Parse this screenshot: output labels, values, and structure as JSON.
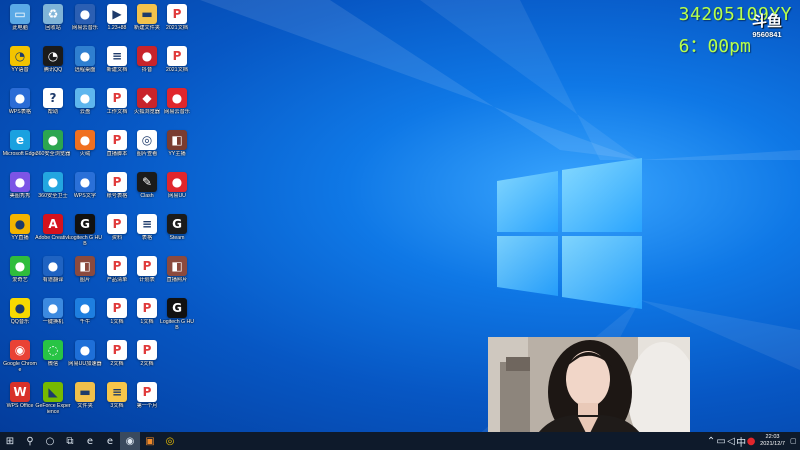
{
  "overlay": {
    "room_id": "34205109YY",
    "schedule": "6：00pm",
    "badge_title": "斗鱼",
    "badge_number": "9560841"
  },
  "desktop": {
    "columns": [
      [
        {
          "label": "此电脑",
          "icon": "computer-icon",
          "color": "#5aa9e6"
        },
        {
          "label": "YY语音",
          "icon": "yy-icon",
          "color": "#f3c400"
        },
        {
          "label": "WPS表格",
          "icon": "spreadsheet-icon",
          "color": "#2b6cd6"
        },
        {
          "label": "Microsoft Edge",
          "icon": "edge-icon",
          "color": "#1aa1e0"
        },
        {
          "label": "美图秀秀",
          "icon": "meitu-icon",
          "color": "#7c55e6"
        },
        {
          "label": "YY直播",
          "icon": "yy-live-icon",
          "color": "#f3b400"
        },
        {
          "label": "爱奇艺",
          "icon": "iqiyi-icon",
          "color": "#2fbd3c"
        },
        {
          "label": "QQ音乐",
          "icon": "qq-music-icon",
          "color": "#f7d900"
        },
        {
          "label": "Google Chrome",
          "icon": "chrome-icon",
          "color": "#e94235"
        },
        {
          "label": "WPS Office",
          "icon": "wps-icon",
          "color": "#d8322a"
        }
      ],
      [
        {
          "label": "回收站",
          "icon": "recycle-bin-icon",
          "color": "#7fb4d8"
        },
        {
          "label": "腾讯QQ",
          "icon": "qq-icon",
          "color": "#1b1b1b"
        },
        {
          "label": "帮助",
          "icon": "help-icon",
          "color": "#ffffff"
        },
        {
          "label": "360安全浏览器",
          "icon": "browser-360-icon",
          "color": "#2ca64f"
        },
        {
          "label": "360安全卫士",
          "icon": "security-360-icon",
          "color": "#23a6e0"
        },
        {
          "label": "Adobe Creative",
          "icon": "adobe-icon",
          "color": "#d5121d"
        },
        {
          "label": "有道翻译",
          "icon": "translate-icon",
          "color": "#1f63c2"
        },
        {
          "label": "一键换机",
          "icon": "migrate-icon",
          "color": "#3c8ae0"
        },
        {
          "label": "微信",
          "icon": "wechat-icon",
          "color": "#28c445"
        },
        {
          "label": "GeForce Experience",
          "icon": "nvidia-icon",
          "color": "#76b900"
        }
      ],
      [
        {
          "label": "网易云音乐",
          "icon": "clock-app-icon",
          "color": "#2b5fb3"
        },
        {
          "label": "远程桌面",
          "icon": "remote-desktop-icon",
          "color": "#2f7fd0"
        },
        {
          "label": "云盘",
          "icon": "cloud-drive-icon",
          "color": "#5eb6ee"
        },
        {
          "label": "火绒",
          "icon": "huorong-icon",
          "color": "#f07020"
        },
        {
          "label": "WPS文字",
          "icon": "wps-writer-icon",
          "color": "#2a70d8"
        },
        {
          "label": "Logitech G HUB",
          "icon": "logitech-icon",
          "color": "#111111"
        },
        {
          "label": "图片",
          "icon": "photo-icon",
          "color": "#8b4a3e"
        },
        {
          "label": "千牛",
          "icon": "qianniu-icon",
          "color": "#1e7fe0"
        },
        {
          "label": "网易UU加速器",
          "icon": "uu-icon",
          "color": "#1e6fd8"
        },
        {
          "label": "文件夹",
          "icon": "folder-icon",
          "color": "#f1c04b"
        }
      ],
      [
        {
          "label": "1.23+88",
          "icon": "media-icon",
          "color": "#ffffff"
        },
        {
          "label": "新建文档",
          "icon": "document-icon",
          "color": "#ffffff"
        },
        {
          "label": "工作文档",
          "icon": "pdf-icon",
          "color": "#ffffff"
        },
        {
          "label": "直播脚本",
          "icon": "pdf-icon",
          "color": "#ffffff"
        },
        {
          "label": "账号表格",
          "icon": "pdf-icon",
          "color": "#ffffff"
        },
        {
          "label": "资料",
          "icon": "pdf-icon",
          "color": "#ffffff"
        },
        {
          "label": "产品清单",
          "icon": "pdf-icon",
          "color": "#ffffff"
        },
        {
          "label": "1文档",
          "icon": "pdf-icon",
          "color": "#ffffff"
        },
        {
          "label": "2文档",
          "icon": "pdf-icon",
          "color": "#ffffff"
        },
        {
          "label": "3文档",
          "icon": "document-icon",
          "color": "#f7c64a"
        }
      ],
      [
        {
          "label": "新建文件夹",
          "icon": "folder-icon",
          "color": "#f2c24c"
        },
        {
          "label": "抖音",
          "icon": "douyin-icon",
          "color": "#c8242b"
        },
        {
          "label": "火狐浏览器",
          "icon": "game-icon",
          "color": "#c8242b"
        },
        {
          "label": "图片查看",
          "icon": "viewer-icon",
          "color": "#ffffff"
        },
        {
          "label": "Clash",
          "icon": "pen-icon",
          "color": "#1b1b1b"
        },
        {
          "label": "表格",
          "icon": "document-icon",
          "color": "#ffffff"
        },
        {
          "label": "计划表",
          "icon": "pdf-icon",
          "color": "#ffffff"
        },
        {
          "label": "1文档",
          "icon": "pdf-icon",
          "color": "#ffffff"
        },
        {
          "label": "2文档",
          "icon": "pdf-icon",
          "color": "#ffffff"
        },
        {
          "label": "第一个月",
          "icon": "pdf-icon",
          "color": "#ffffff"
        }
      ],
      [
        {
          "label": "2021文档",
          "icon": "pdf-icon",
          "color": "#ffffff"
        },
        {
          "label": "2021文档",
          "icon": "pdf-icon",
          "color": "#ffffff"
        },
        {
          "label": "网易云音乐",
          "icon": "netease-music-icon",
          "color": "#e0262c"
        },
        {
          "label": "YY主播",
          "icon": "avatar-icon",
          "color": "#7a3c30"
        },
        {
          "label": "网易UU",
          "icon": "netease-uu-icon",
          "color": "#e0262c"
        },
        {
          "label": "Steam",
          "icon": "g-icon",
          "color": "#1b1b1b"
        },
        {
          "label": "直播照片",
          "icon": "photo-icon",
          "color": "#8b4a3e"
        },
        {
          "label": "Logitech G HUB",
          "icon": "logitech-icon",
          "color": "#111111"
        }
      ]
    ]
  },
  "taskbar": {
    "items": [
      {
        "name": "start-button",
        "glyph": "⊞"
      },
      {
        "name": "search-icon",
        "glyph": "⚲"
      },
      {
        "name": "cortana-icon",
        "glyph": "○"
      },
      {
        "name": "task-view-icon",
        "glyph": "⧉"
      },
      {
        "name": "edge-taskbar-icon",
        "glyph": "e"
      },
      {
        "name": "browser-360-taskbar-icon",
        "glyph": "e"
      },
      {
        "name": "obs-taskbar-icon",
        "glyph": "◉"
      },
      {
        "name": "app-taskbar-icon",
        "glyph": "▣"
      },
      {
        "name": "yy-taskbar-icon",
        "glyph": "◎"
      }
    ],
    "clock_time": "22:03",
    "clock_date": "2021/12/7"
  },
  "colors": {
    "overlay_text": "#b7ff4a",
    "taskbar_bg": "#0e1a2b"
  }
}
